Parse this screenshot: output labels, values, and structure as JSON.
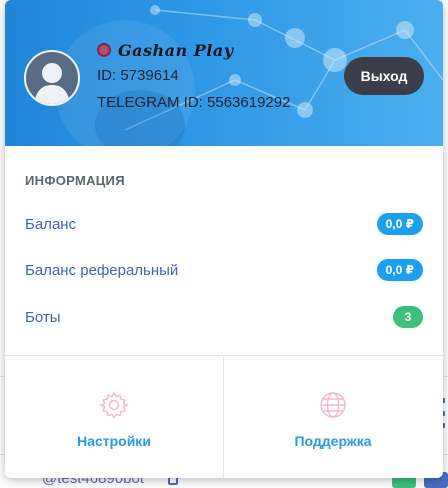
{
  "profile": {
    "brand_name": "Gashan Play",
    "id_text": "ID: 5739614",
    "telegram_text": "TELEGRAM ID: 5563619292",
    "logout_label": "Выход"
  },
  "info": {
    "title": "ИНФОРМАЦИЯ",
    "rows": [
      {
        "label": "Баланс",
        "value": "0,0 ₽",
        "color": "#1aa0ee"
      },
      {
        "label": "Баланс реферальный",
        "value": "0,0 ₽",
        "color": "#1aa0ee"
      },
      {
        "label": "Боты",
        "value": "3",
        "color": "#3ec07c"
      }
    ]
  },
  "actions": {
    "settings_label": "Настройки",
    "settings_icon": "gear-icon",
    "support_label": "Поддержка",
    "support_icon": "globe-icon"
  },
  "background": {
    "bot_handle": "@test46890bot"
  },
  "colors": {
    "header_blue": "#2f98e6",
    "accent_blue": "#3d63c4",
    "action_blue": "#2a9ae8",
    "logout_dark": "#3b3d4a",
    "badge_green": "#3ec07c"
  }
}
